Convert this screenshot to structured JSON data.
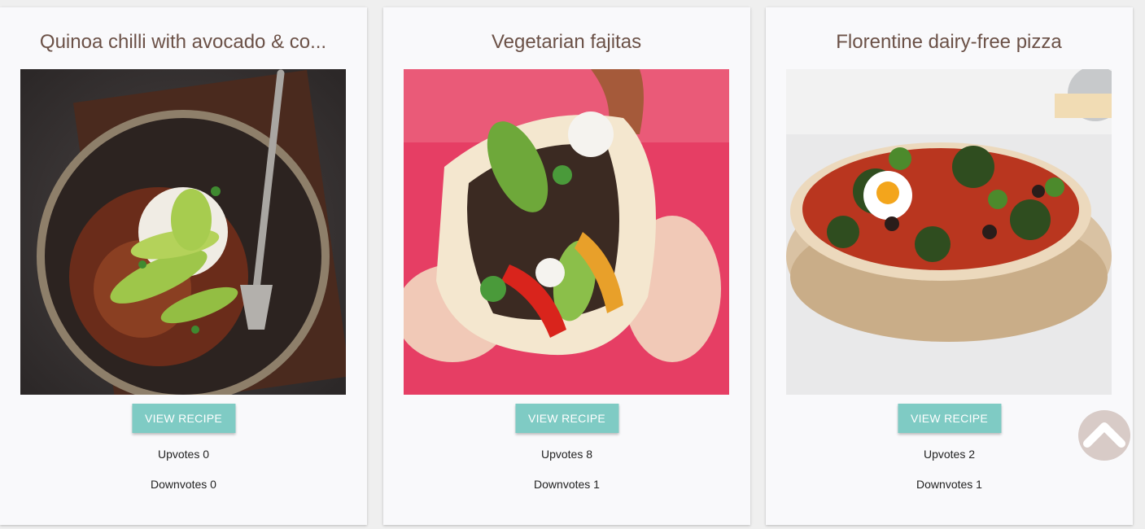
{
  "cards": [
    {
      "title": "Quinoa chilli with avocado & co...",
      "button_label": "VIEW RECIPE",
      "upvotes_text": "Upvotes 0",
      "downvotes_text": "Downvotes 0",
      "upvotes": 0,
      "downvotes": 0,
      "image_subject": "quinoa chilli bowl with avocado and yogurt"
    },
    {
      "title": "Vegetarian fajitas",
      "button_label": "VIEW RECIPE",
      "upvotes_text": "Upvotes 8",
      "downvotes_text": "Downvotes 1",
      "upvotes": 8,
      "downvotes": 1,
      "image_subject": "hands holding a vegetarian fajita"
    },
    {
      "title": "Florentine dairy-free pizza",
      "button_label": "VIEW RECIPE",
      "upvotes_text": "Upvotes 2",
      "downvotes_text": "Downvotes 1",
      "upvotes": 2,
      "downvotes": 1,
      "image_subject": "florentine pizza with egg and spinach"
    }
  ],
  "scroll_top_icon": "chevron-up-icon",
  "colors": {
    "accent_button": "#7fcbc4",
    "title_text": "#6b5147",
    "card_background": "#f9f9fb",
    "scroll_button": "#d8cbc7"
  }
}
